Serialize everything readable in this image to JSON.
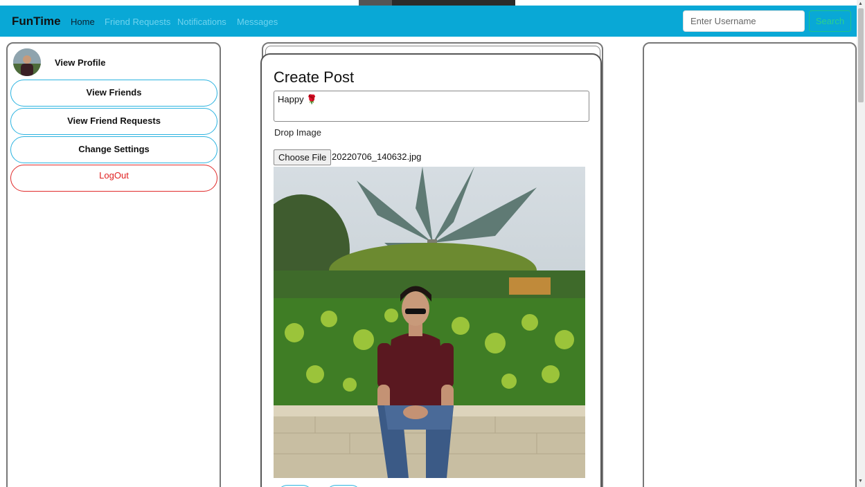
{
  "navbar": {
    "brand": "FunTime",
    "links": [
      "Home",
      "Friend Requests",
      "Notifications",
      "Messages"
    ],
    "search_placeholder": "Enter Username",
    "search_button": "Search"
  },
  "sidebar": {
    "profile_link": "View Profile",
    "buttons": [
      "View Friends",
      "View Friend Requests",
      "Change Settings"
    ],
    "logout": "LogOut"
  },
  "create_post": {
    "title": "Create Post",
    "text_value": "Happy",
    "text_emoji": "🌹",
    "drop_label": "Drop Image",
    "choose_file_label": "Choose File",
    "file_name": "20220706_140632.jpg"
  },
  "colors": {
    "navbar": "#09a8d6",
    "button_border": "#2bb3e0",
    "logout": "#e02020",
    "search_button": "#2bd08f"
  },
  "icons": [
    "avatar-image",
    "uploaded-photo-preview",
    "rose-emoji"
  ]
}
